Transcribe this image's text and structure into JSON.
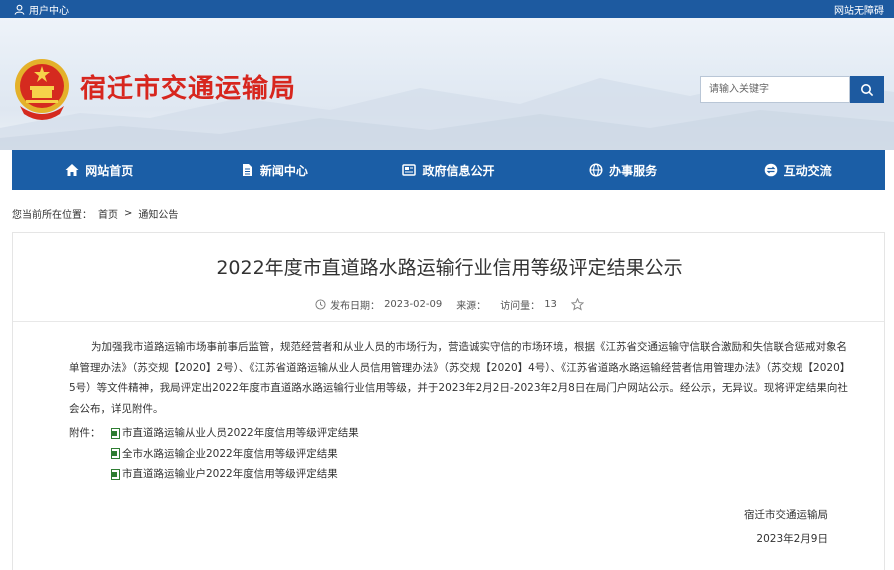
{
  "topbar": {
    "user_center": "用户中心",
    "accessible": "网站无障碍"
  },
  "header": {
    "site_title": "宿迁市交通运输局",
    "search_placeholder": "请输入关键字"
  },
  "nav": {
    "items": [
      {
        "label": "网站首页",
        "icon": "home-icon"
      },
      {
        "label": "新闻中心",
        "icon": "document-icon"
      },
      {
        "label": "政府信息公开",
        "icon": "newspaper-icon"
      },
      {
        "label": "办事服务",
        "icon": "globe-icon"
      },
      {
        "label": "互动交流",
        "icon": "exchange-icon"
      }
    ]
  },
  "breadcrumb": {
    "prefix": "您当前所在位置：",
    "home": "首页",
    "separator": ">",
    "current": "通知公告"
  },
  "article": {
    "title": "2022年度市直道路水路运输行业信用等级评定结果公示",
    "publish_label": "发布日期：",
    "publish_date": "2023-02-09",
    "source_label": "来源：",
    "views_label": "访问量：",
    "views": "13",
    "body": "为加强我市道路运输市场事前事后监管，规范经营者和从业人员的市场行为，营造诚实守信的市场环境，根据《江苏省交通运输守信联合激励和失信联合惩戒对象名单管理办法》（苏交规【2020】2号）、《江苏省道路运输从业人员信用管理办法》（苏交规【2020】4号）、《江苏省道路水路运输经营者信用管理办法》（苏交规【2020】5号）等文件精神，我局评定出2022年度市直道路水路运输行业信用等级，并于2023年2月2日-2023年2月8日在局门户网站公示。经公示，无异议。现将评定结果向社会公布，详见附件。",
    "attachments_label": "附件：",
    "attachments": [
      "市直道路运输从业人员2022年度信用等级评定结果",
      "全市水路运输企业2022年度信用等级评定结果",
      "市直道路运输业户2022年度信用等级评定结果"
    ],
    "signature": "宿迁市交通运输局",
    "sign_date": "2023年2月9日"
  },
  "colors": {
    "brand_blue": "#1b5ea6",
    "title_red": "#d7261e"
  }
}
